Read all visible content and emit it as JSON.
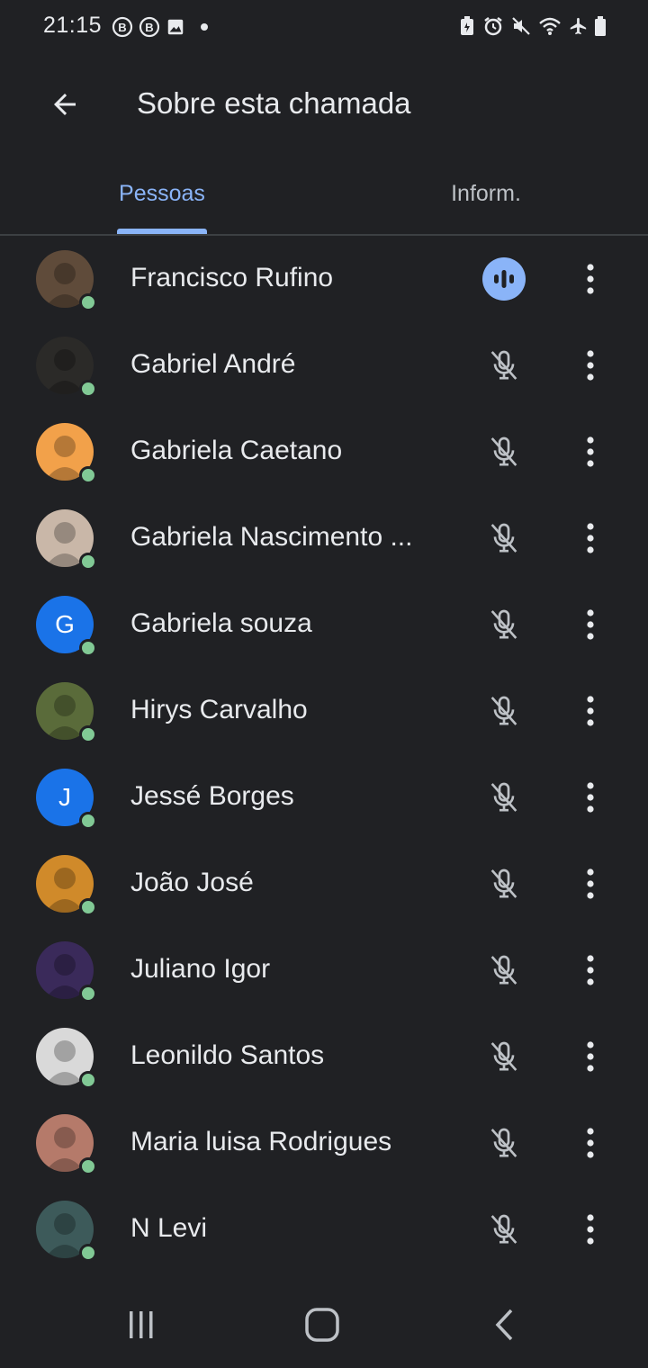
{
  "status_bar": {
    "time": "21:15",
    "left_icons": [
      "b-icon",
      "b-icon",
      "image-icon",
      "dot-icon"
    ],
    "right_icons": [
      "battery-saver-icon",
      "alarm-icon",
      "mute-icon",
      "wifi-icon",
      "airplane-icon",
      "battery-icon"
    ]
  },
  "app_bar": {
    "title": "Sobre esta chamada"
  },
  "tabs": [
    {
      "label": "Pessoas",
      "active": true
    },
    {
      "label": "Inform.",
      "active": false
    }
  ],
  "participants": [
    {
      "name": "Francisco Rufino",
      "avatar_letter": "",
      "avatar_color": "#5f4b3a",
      "speaking": true
    },
    {
      "name": "Gabriel André",
      "avatar_letter": "",
      "avatar_color": "#2b2a28",
      "speaking": false
    },
    {
      "name": "Gabriela Caetano",
      "avatar_letter": "",
      "avatar_color": "#f2a14a",
      "speaking": false
    },
    {
      "name": "Gabriela Nascimento ...",
      "avatar_letter": "",
      "avatar_color": "#c9b7a8",
      "speaking": false
    },
    {
      "name": "Gabriela souza",
      "avatar_letter": "G",
      "avatar_color": "#1a73e8",
      "speaking": false
    },
    {
      "name": "Hirys Carvalho",
      "avatar_letter": "",
      "avatar_color": "#5a6b3a",
      "speaking": false
    },
    {
      "name": "Jessé Borges",
      "avatar_letter": "J",
      "avatar_color": "#1a73e8",
      "speaking": false
    },
    {
      "name": "João José",
      "avatar_letter": "",
      "avatar_color": "#d08a2a",
      "speaking": false
    },
    {
      "name": "Juliano Igor",
      "avatar_letter": "",
      "avatar_color": "#3a2a5a",
      "speaking": false
    },
    {
      "name": "Leonildo Santos",
      "avatar_letter": "",
      "avatar_color": "#d9d9d9",
      "speaking": false
    },
    {
      "name": "Maria luisa Rodrigues",
      "avatar_letter": "",
      "avatar_color": "#b57a6a",
      "speaking": false
    },
    {
      "name": "N Levi",
      "avatar_letter": "",
      "avatar_color": "#3d5a5a",
      "speaking": false
    }
  ],
  "colors": {
    "background": "#202124",
    "accent": "#8ab4f8",
    "online": "#81c995",
    "letter_avatar": "#1a73e8"
  },
  "nav_bar": {
    "buttons": [
      "recent-apps-icon",
      "home-icon",
      "back-icon"
    ]
  }
}
